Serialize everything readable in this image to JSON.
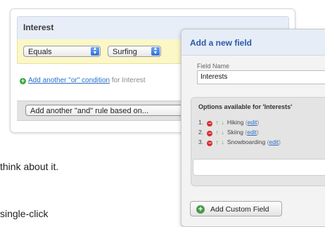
{
  "condition_panel": {
    "title": "Interest",
    "operator_select": "Equals",
    "value_select": "Surfing",
    "add_or_link": "Add another \"or\" condition",
    "add_or_suffix": "for Interest",
    "add_and_button": "Add another \"and\" rule based on..."
  },
  "background_text": {
    "line1": "think about it.",
    "line2": "single-click"
  },
  "field_panel": {
    "title": "Add a new field",
    "field_name_label": "Field Name",
    "field_name_value": "Interests",
    "options_title": "Options available for 'Interests'",
    "options": [
      {
        "num": "1.",
        "label": "Hiking",
        "edit": "edit"
      },
      {
        "num": "2.",
        "label": "Skiing",
        "edit": "edit"
      },
      {
        "num": "3.",
        "label": "Snowboarding",
        "edit": "edit"
      }
    ],
    "add_button": "Add Custom Field"
  },
  "icons": {
    "plus": "plus-icon",
    "remove": "minus-circle-icon",
    "move_up": "arrow-up-icon",
    "move_down": "arrow-down-icon",
    "select_arrows": "updown-arrows-icon"
  },
  "colors": {
    "link": "#2a6ec9",
    "title_blue": "#2a5aa8",
    "condition_row": "#fbf7c6"
  }
}
